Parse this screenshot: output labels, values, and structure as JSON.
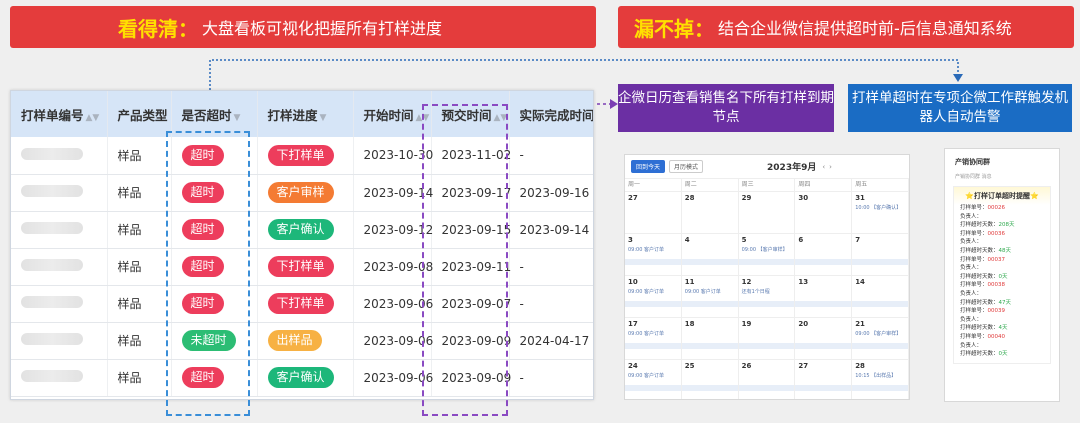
{
  "banners": {
    "left": {
      "highlight": "看得清：",
      "text": "大盘看板可视化把握所有打样进度"
    },
    "right": {
      "highlight": "漏不掉：",
      "text": "结合企业微信提供超时前-后信息通知系统"
    }
  },
  "callouts": {
    "purple": "企微日历查看销售名下所有打样到期节点",
    "blue": "打样单超时在专项企微工作群触发机器人自动告警"
  },
  "table": {
    "headers": [
      "打样单编号",
      "产品类型",
      "是否超时",
      "打样进度",
      "开始时间",
      "预交时间",
      "实际完成时间"
    ],
    "rows": [
      {
        "type": "样品",
        "overdue": "超时",
        "overdue_color": "#ed3d5c",
        "progress": "下打样单",
        "progress_color": "#ed3d5c",
        "start": "2023-10-30",
        "due": "2023-11-02",
        "done": "-"
      },
      {
        "type": "样品",
        "overdue": "超时",
        "overdue_color": "#ed3d5c",
        "progress": "客户审样",
        "progress_color": "#f47b33",
        "start": "2023-09-14",
        "due": "2023-09-17",
        "done": "2023-09-16"
      },
      {
        "type": "样品",
        "overdue": "超时",
        "overdue_color": "#ed3d5c",
        "progress": "客户确认",
        "progress_color": "#1db77a",
        "start": "2023-09-12",
        "due": "2023-09-15",
        "done": "2023-09-14"
      },
      {
        "type": "样品",
        "overdue": "超时",
        "overdue_color": "#ed3d5c",
        "progress": "下打样单",
        "progress_color": "#ed3d5c",
        "start": "2023-09-08",
        "due": "2023-09-11",
        "done": "-"
      },
      {
        "type": "样品",
        "overdue": "超时",
        "overdue_color": "#ed3d5c",
        "progress": "下打样单",
        "progress_color": "#ed3d5c",
        "start": "2023-09-06",
        "due": "2023-09-07",
        "done": "-"
      },
      {
        "type": "样品",
        "overdue": "未超时",
        "overdue_color": "#2cbd74",
        "progress": "出样品",
        "progress_color": "#f7b143",
        "start": "2023-09-06",
        "due": "2023-09-09",
        "done": "2024-04-17"
      },
      {
        "type": "样品",
        "overdue": "超时",
        "overdue_color": "#ed3d5c",
        "progress": "客户确认",
        "progress_color": "#1db77a",
        "start": "2023-09-06",
        "due": "2023-09-09",
        "done": "-"
      }
    ]
  },
  "calendar": {
    "today_btn": "回到今天",
    "mode_btn": "月历模式",
    "title": "2023年9月",
    "weekdays": [
      "周一",
      "周二",
      "周三",
      "周四",
      "周五"
    ],
    "weeks": [
      [
        {
          "d": "27",
          "ev": ""
        },
        {
          "d": "28",
          "ev": ""
        },
        {
          "d": "29",
          "ev": ""
        },
        {
          "d": "30",
          "ev": ""
        },
        {
          "d": "31",
          "ev": "10:00 【客户确认】"
        }
      ],
      [
        {
          "d": "3",
          "ev": "09:00 客户订单"
        },
        {
          "d": "4",
          "ev": ""
        },
        {
          "d": "5",
          "ev": "09:00 【客户审样】"
        },
        {
          "d": "6",
          "ev": ""
        },
        {
          "d": "7",
          "ev": ""
        }
      ],
      [
        {
          "d": "10",
          "ev": "09:00 客户订单"
        },
        {
          "d": "11",
          "ev": "09:00 客户订单"
        },
        {
          "d": "12",
          "ev": "还有1个日程"
        },
        {
          "d": "13",
          "ev": ""
        },
        {
          "d": "14",
          "ev": ""
        }
      ],
      [
        {
          "d": "17",
          "ev": "09:00 客户订单"
        },
        {
          "d": "18",
          "ev": ""
        },
        {
          "d": "19",
          "ev": ""
        },
        {
          "d": "20",
          "ev": ""
        },
        {
          "d": "21",
          "ev": "09:00 【客户审样】"
        }
      ],
      [
        {
          "d": "24",
          "ev": "09:00 客户订单"
        },
        {
          "d": "25",
          "ev": ""
        },
        {
          "d": "26",
          "ev": ""
        },
        {
          "d": "27",
          "ev": ""
        },
        {
          "d": "28",
          "ev": "10:15 【出样品】"
        }
      ]
    ]
  },
  "chat": {
    "title": "产销协同群",
    "subtitle": "产销协同群 消息",
    "card_title": "打样订单超时提醒",
    "lines": [
      {
        "k": "打样单号：",
        "v": "00026",
        "c": "v"
      },
      {
        "k": "负责人：",
        "v": "",
        "c": ""
      },
      {
        "k": "打样超时天数：",
        "v": "208天",
        "c": "g"
      },
      {
        "k": "打样单号：",
        "v": "00036",
        "c": "v"
      },
      {
        "k": "负责人：",
        "v": "",
        "c": ""
      },
      {
        "k": "打样超时天数：",
        "v": "48天",
        "c": "g"
      },
      {
        "k": "打样单号：",
        "v": "00037",
        "c": "v"
      },
      {
        "k": "负责人：",
        "v": "",
        "c": ""
      },
      {
        "k": "打样超时天数：",
        "v": "0天",
        "c": "g"
      },
      {
        "k": "打样单号：",
        "v": "00038",
        "c": "v"
      },
      {
        "k": "负责人：",
        "v": "",
        "c": ""
      },
      {
        "k": "打样超时天数：",
        "v": "47天",
        "c": "g"
      },
      {
        "k": "打样单号：",
        "v": "00039",
        "c": "v"
      },
      {
        "k": "负责人：",
        "v": "",
        "c": ""
      },
      {
        "k": "打样超时天数：",
        "v": "4天",
        "c": "g"
      },
      {
        "k": "打样单号：",
        "v": "00040",
        "c": "v"
      },
      {
        "k": "负责人：",
        "v": "",
        "c": ""
      },
      {
        "k": "打样超时天数：",
        "v": "0天",
        "c": "g"
      }
    ]
  }
}
